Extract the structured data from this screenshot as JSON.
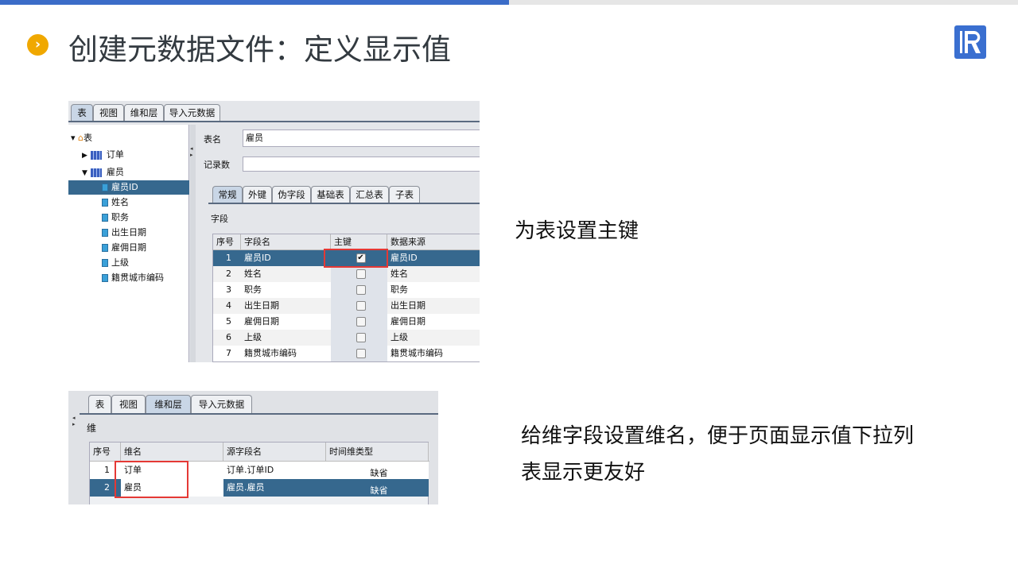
{
  "slide": {
    "title": "创建元数据文件：定义显示值",
    "note1": "为表设置主键",
    "note2_line1": "给维字段设置维名，便于页面显示值下拉列",
    "note2_line2": "表显示更友好",
    "colors": {
      "accent": "#3b6cc8",
      "bullet": "#f0a800",
      "selection": "#36688e",
      "highlight_box": "#e53935"
    }
  },
  "shot1": {
    "tabs": [
      "表",
      "视图",
      "维和层",
      "导入元数据"
    ],
    "selected_tab": 0,
    "tree": {
      "root": "表",
      "tables": [
        {
          "label": "订单",
          "expanded": false
        },
        {
          "label": "雇员",
          "expanded": true
        }
      ],
      "fields": [
        "雇员ID",
        "姓名",
        "职务",
        "出生日期",
        "雇佣日期",
        "上级",
        "籍贯城市编码"
      ],
      "selected_field": 0
    },
    "form": {
      "table_name_label": "表名",
      "table_name_value": "雇员",
      "record_count_label": "记录数",
      "record_count_value": ""
    },
    "inner_tabs": [
      "常规",
      "外键",
      "伪字段",
      "基础表",
      "汇总表",
      "子表"
    ],
    "section_label": "字段",
    "columns": [
      "序号",
      "字段名",
      "主键",
      "数据来源"
    ],
    "rows": [
      {
        "no": "1",
        "name": "雇员ID",
        "pk": true,
        "source": "雇员ID"
      },
      {
        "no": "2",
        "name": "姓名",
        "pk": false,
        "source": "姓名"
      },
      {
        "no": "3",
        "name": "职务",
        "pk": false,
        "source": "职务"
      },
      {
        "no": "4",
        "name": "出生日期",
        "pk": false,
        "source": "出生日期"
      },
      {
        "no": "5",
        "name": "雇佣日期",
        "pk": false,
        "source": "雇佣日期"
      },
      {
        "no": "6",
        "name": "上级",
        "pk": false,
        "source": "上级"
      },
      {
        "no": "7",
        "name": "籍贯城市编码",
        "pk": false,
        "source": "籍贯城市编码"
      }
    ]
  },
  "shot2": {
    "tabs": [
      "表",
      "视图",
      "维和层",
      "导入元数据"
    ],
    "selected_tab": 2,
    "section_label": "维",
    "columns": [
      "序号",
      "维名",
      "源字段名",
      "时间维类型"
    ],
    "rows": [
      {
        "no": "1",
        "name": "订单",
        "source": "订单.订单ID",
        "type": "缺省"
      },
      {
        "no": "2",
        "name": "雇员",
        "source": "雇员.雇员",
        "type": "缺省"
      }
    ]
  }
}
